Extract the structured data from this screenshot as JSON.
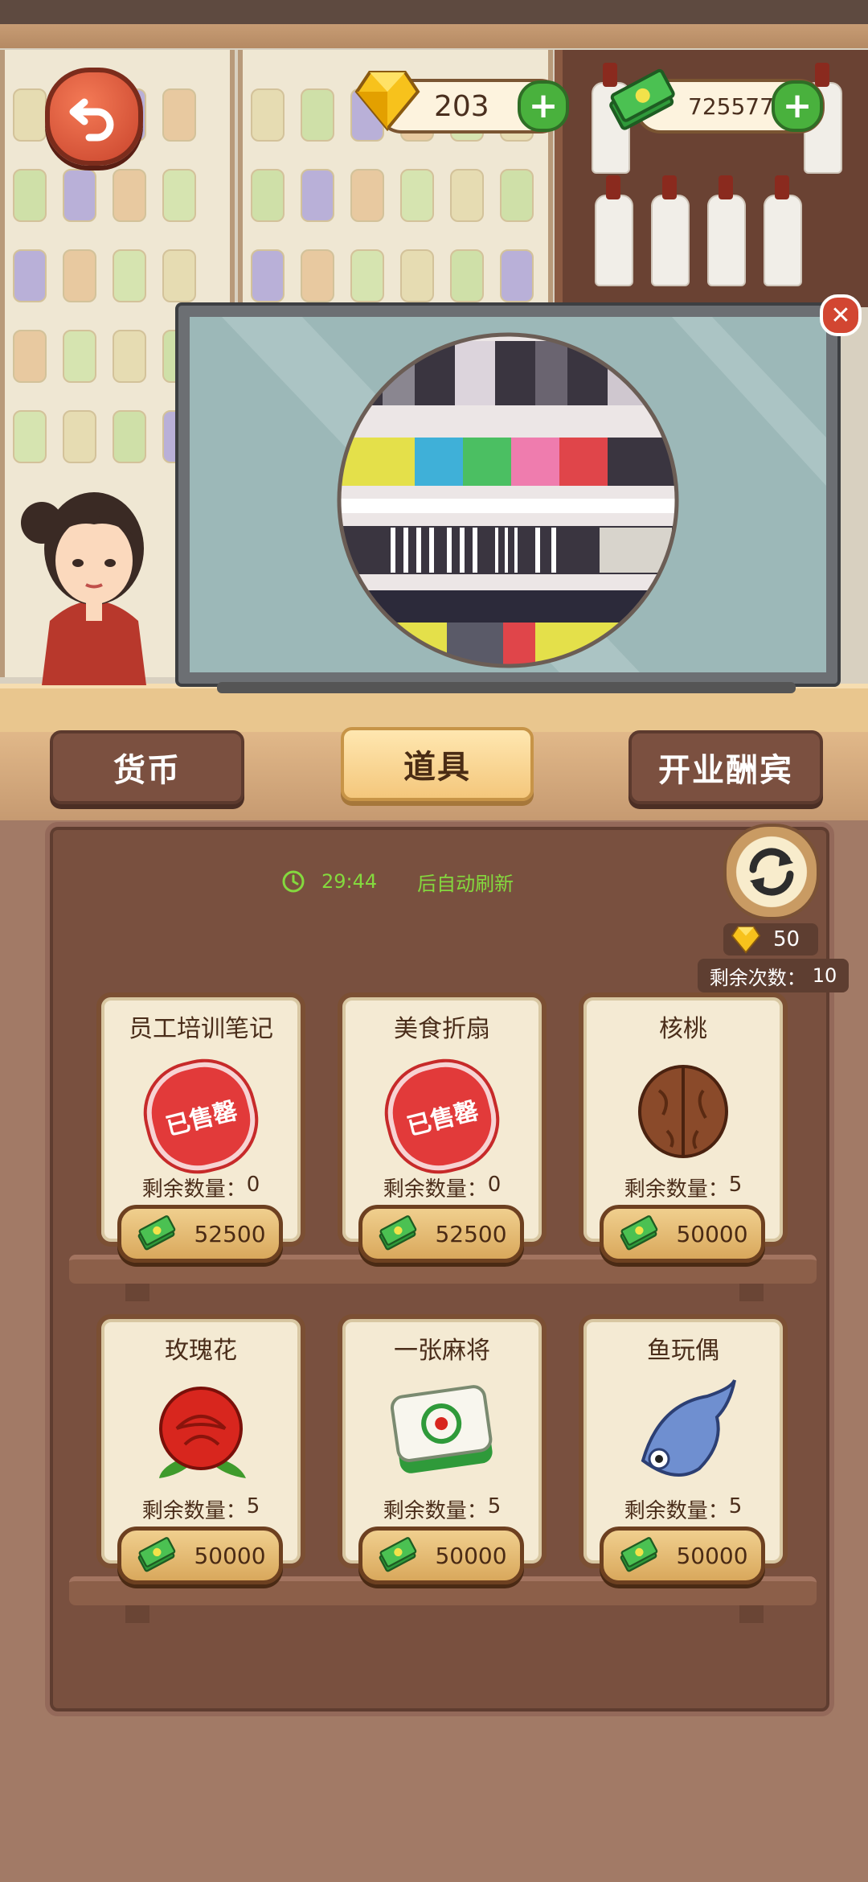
{
  "header": {
    "gems": "203",
    "cash": "7255772"
  },
  "tabs": [
    {
      "label": "货币",
      "active": false
    },
    {
      "label": "道具",
      "active": true
    },
    {
      "label": "开业酬宾",
      "active": false
    }
  ],
  "shop": {
    "timer": "29:44",
    "timer_suffix": "后自动刷新",
    "refresh_cost": "50",
    "refresh_remaining_label": "剩余次数：",
    "refresh_remaining": "10",
    "qty_label": "剩余数量：",
    "sold_out_label": "已售罄",
    "items": [
      {
        "name": "员工培训笔记",
        "qty": "0",
        "price": "52500",
        "sold_out": true,
        "icon": "notebook-icon"
      },
      {
        "name": "美食折扇",
        "qty": "0",
        "price": "52500",
        "sold_out": true,
        "icon": "fan-icon"
      },
      {
        "name": "核桃",
        "qty": "5",
        "price": "50000",
        "sold_out": false,
        "icon": "walnut-icon"
      },
      {
        "name": "玫瑰花",
        "qty": "5",
        "price": "50000",
        "sold_out": false,
        "icon": "rose-icon"
      },
      {
        "name": "一张麻将",
        "qty": "5",
        "price": "50000",
        "sold_out": false,
        "icon": "mahjong-tile-icon"
      },
      {
        "name": "鱼玩偶",
        "qty": "5",
        "price": "50000",
        "sold_out": false,
        "icon": "fish-doll-icon"
      }
    ]
  },
  "colors": {
    "accent_green": "#49b13d",
    "timer_text": "#84d93e",
    "panel_bg": "#79503f",
    "tab_active": "#f4c77c"
  }
}
